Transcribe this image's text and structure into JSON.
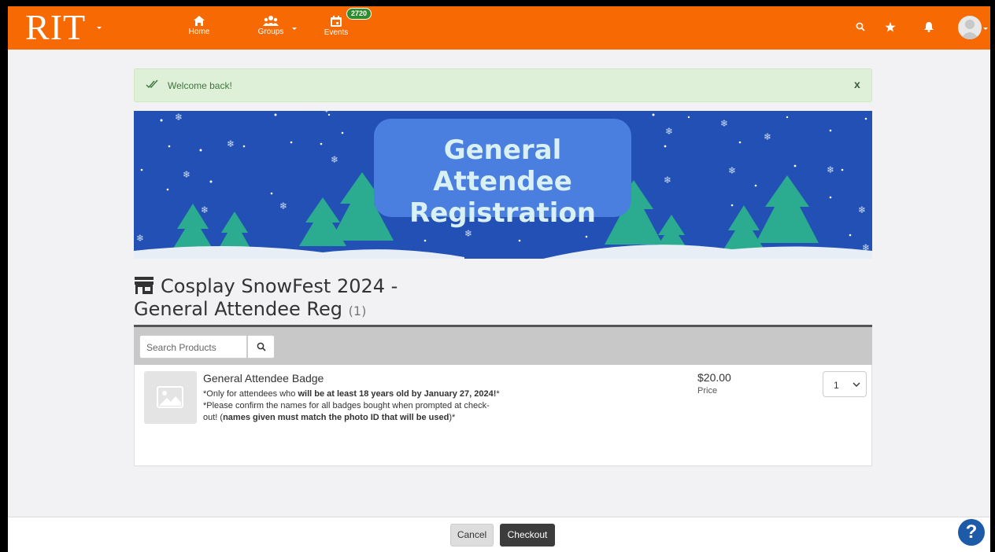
{
  "brand": {
    "logo": "RIT",
    "accent": "#f76902"
  },
  "nav": {
    "home_label": "Home",
    "groups_label": "Groups",
    "events_label": "Events",
    "events_badge": "2720"
  },
  "alert": {
    "message": "Welcome back!",
    "close": "x",
    "color": "#dff0d8"
  },
  "banner": {
    "title_line1": "General Attendee",
    "title_line2": "Registration"
  },
  "store": {
    "title_line1": "Cosplay SnowFest 2024 -",
    "title_line2": "General Attendee Reg",
    "count": "(1)"
  },
  "search": {
    "placeholder": "Search Products"
  },
  "products": [
    {
      "name": "General Attendee Badge",
      "desc1_pre": "*Only for attendees who ",
      "desc1_bold": "will be at least 18 years old by January 27, 2024!",
      "desc1_post": "*",
      "desc2_pre": "*Please confirm the names for all badges bought when prompted at check-out! (",
      "desc2_bold": "names given must match the photo ID that will be used",
      "desc2_post": ")*",
      "price": "$20.00",
      "price_label": "Price",
      "quantity": "1"
    }
  ],
  "footer": {
    "cancel_label": "Cancel",
    "checkout_label": "Checkout",
    "help_label": "?"
  }
}
